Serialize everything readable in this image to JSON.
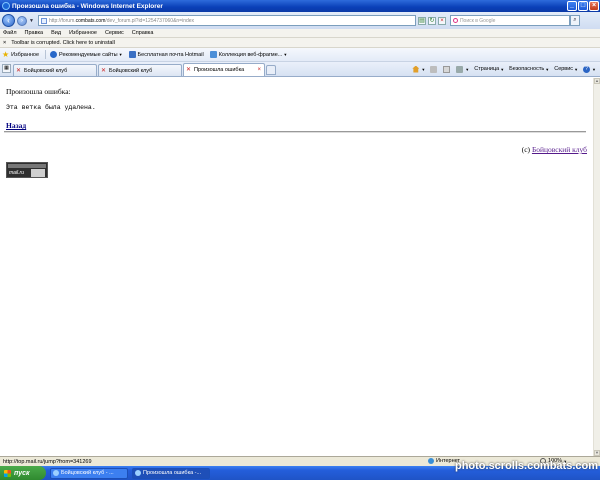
{
  "window": {
    "title": "Произошла ошибка - Windows Internet Explorer"
  },
  "address": {
    "url_prefix": "http://forum.",
    "url_host": "combats.com",
    "url_rest": "/dev_forum.pl?id=1254737060&n=index",
    "search_placeholder": "Поиск в Google"
  },
  "menu": {
    "items": [
      "Файл",
      "Правка",
      "Вид",
      "Избранное",
      "Сервис",
      "Справка"
    ]
  },
  "notification": {
    "text": "Toolbar is corrupted. Click here to uninstall"
  },
  "favorites": {
    "label": "Избранное",
    "items": [
      "Рекомендуемые сайты",
      "Бесплатная почта Hotmail",
      "Коллекция веб-фрагме..."
    ]
  },
  "tabs": [
    {
      "label": "Бойцовский клуб"
    },
    {
      "label": "Бойцовский клуб"
    },
    {
      "label": "Произошла ошибка"
    }
  ],
  "commands": {
    "page": "Страница",
    "security": "Безопасность",
    "service": "Сервис"
  },
  "content": {
    "error_title": "Произошла ошибка:",
    "error_text": "Эта ветка была удалена.",
    "back_link": "Назад",
    "copyright_prefix": "(c)",
    "copyright_link": "Бойцовский клуб",
    "counter_logo": "mail.ru"
  },
  "status": {
    "url": "http://top.mail.ru/jump?from=341269",
    "zone": "Интернет",
    "zoom": "100%"
  },
  "taskbar": {
    "start": "пуск",
    "tasks": [
      {
        "label": "Бойцовский клуб - ..."
      },
      {
        "label": "Произошла ошибка -..."
      }
    ]
  },
  "watermark": "photo.scrolls.combats.com"
}
